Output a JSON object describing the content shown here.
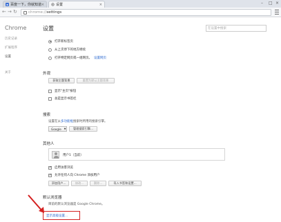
{
  "tabs": [
    {
      "title": "百度一下，你就知道",
      "close": "×"
    },
    {
      "title": "设置",
      "close": "×"
    }
  ],
  "window_controls": {
    "min": "–",
    "max": "□",
    "close": "×"
  },
  "address": {
    "scheme": "chrome://",
    "path": "settings"
  },
  "sidebar": {
    "brand": "Chrome",
    "items": [
      {
        "label": "历史记录"
      },
      {
        "label": "扩展程序"
      },
      {
        "label": "设置"
      },
      {
        "label": "关于"
      }
    ]
  },
  "main": {
    "title": "设置",
    "search_placeholder": "在设置中搜索",
    "startup": {
      "options": [
        {
          "label": "打开新标签页",
          "selected": true
        },
        {
          "label": "从上次停下的地方继续",
          "selected": false
        },
        {
          "label": "打开特定网页或一组网页。",
          "link": "设置网页",
          "selected": false
        }
      ]
    },
    "appearance": {
      "title": "外观",
      "get_themes": "获取主题背景",
      "reset_theme": "重置为默认主题背景",
      "show_home": "显示\"主页\"按钮",
      "show_bookmarks": "总是显示书签栏"
    },
    "search": {
      "title": "搜索",
      "desc": "设置在从",
      "desc_link": "多功能框",
      "desc_tail": "搜索时所用的搜索引擎。",
      "engine": "Google",
      "manage": "管理搜索引擎..."
    },
    "people": {
      "title": "其他人",
      "user": "用户1（当前）",
      "guest": "启用访客浏览",
      "allow_add": "允许任何人向 Chrome 添加用户",
      "add": "添加用户...",
      "edit": "修改...",
      "remove": "删除...",
      "import": "导入书签和设置..."
    },
    "default_browser": {
      "title": "默认浏览器",
      "desc": "目前的默认浏览器是 Google Chrome。"
    },
    "advanced": "显示高级设置..."
  }
}
